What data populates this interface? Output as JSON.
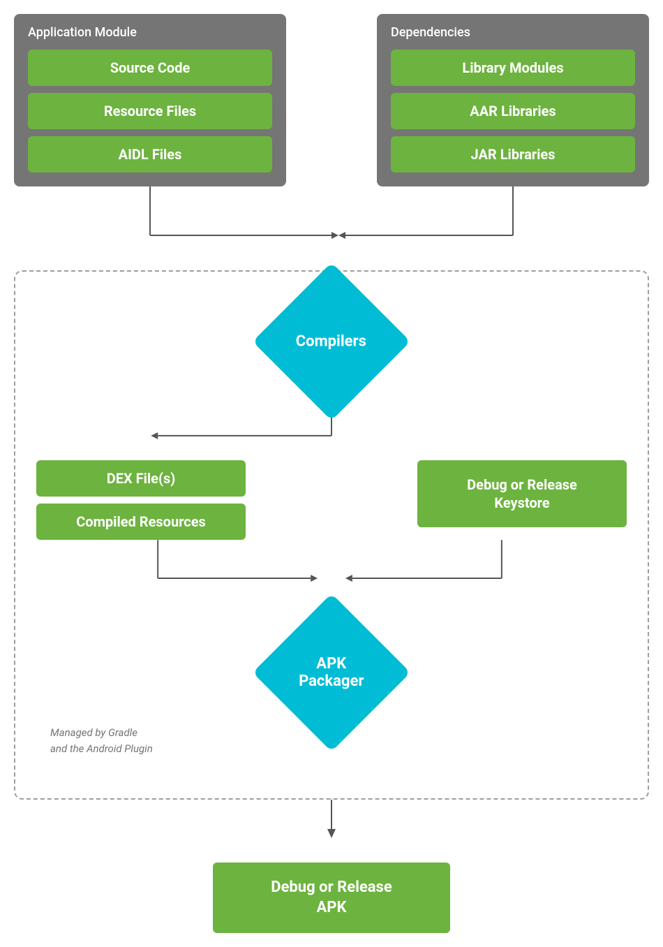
{
  "appModule": {
    "title": "Application Module",
    "items": [
      "Source Code",
      "Resource Files",
      "AIDL Files"
    ]
  },
  "dependencies": {
    "title": "Dependencies",
    "items": [
      "Library Modules",
      "AAR Libraries",
      "JAR Libraries"
    ]
  },
  "compilers": {
    "label": "Compilers"
  },
  "dexFiles": {
    "label": "DEX File(s)"
  },
  "compiledResources": {
    "label": "Compiled Resources"
  },
  "debugKeystore": {
    "label": "Debug or Release\nKeystore"
  },
  "apkPackager": {
    "label": "APK\nPackager"
  },
  "gradleLabel": {
    "line1": "Managed by Gradle",
    "line2": "and the Android Plugin"
  },
  "finalApk": {
    "label": "Debug or Release\nAPK"
  }
}
